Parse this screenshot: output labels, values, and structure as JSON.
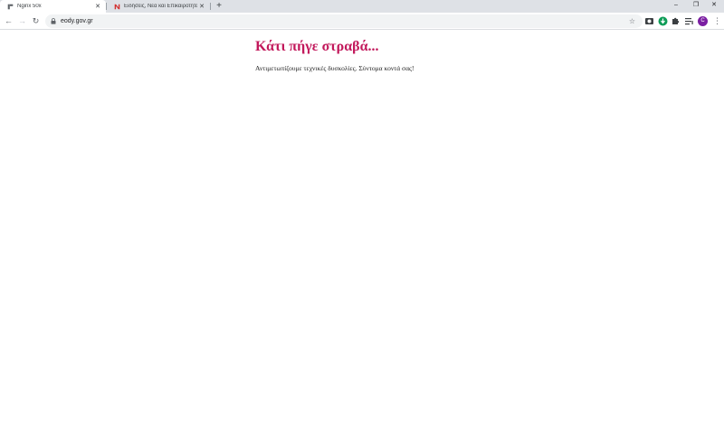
{
  "browser": {
    "tabs": [
      {
        "title": "Nginx 50x",
        "favicon": "nginx-icon",
        "active": true
      },
      {
        "title": "Ειδήσεις, Νέα και Επικαιρότητα",
        "favicon": "news-n-icon",
        "active": false
      }
    ],
    "new_tab_symbol": "+",
    "window_controls": {
      "minimize": "–",
      "restore": "❐",
      "close": "✕"
    },
    "toolbar": {
      "back": "←",
      "forward": "→",
      "reload": "↻",
      "url": "eody.gov.gr",
      "bookmark": "☆",
      "menu": "⋮"
    },
    "profile_initial": "C",
    "accent_color": "#7b1fa2"
  },
  "page": {
    "heading": "Κάτι πήγε στραβά...",
    "message": "Αντιμετωπίζουμε τεχνικές δυσκολίες. Σύντομα κοντά σας!",
    "heading_color": "#c2185b"
  }
}
